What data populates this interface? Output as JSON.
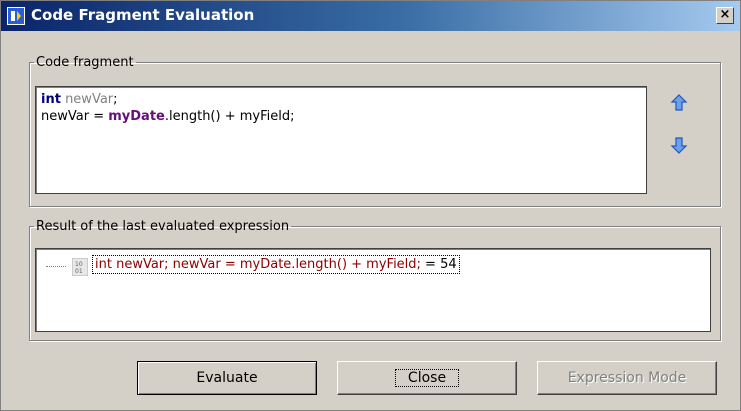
{
  "window": {
    "title": "Code Fragment Evaluation",
    "close_glyph": "×"
  },
  "code_group": {
    "legend": "Code fragment",
    "line1_keyword": "int",
    "line1_var": " newVar",
    "line1_end": ";",
    "line2_start": "newVar = ",
    "line2_field": "myDate",
    "line2_end": ".length() + myField;"
  },
  "result_group": {
    "legend": "Result of the last evaluated expression",
    "expression": "int newVar;  newVar = myDate.length() + myField;",
    "value": " = 54"
  },
  "buttons": {
    "evaluate": "Evaluate",
    "close": "Close",
    "expression_mode": "Expression Mode"
  },
  "icons": {
    "app": "code-eval-app-icon",
    "history_up": "up-arrow-icon",
    "history_down": "down-arrow-icon",
    "result": "number-value-icon"
  },
  "colors": {
    "title_gradient_start": "#0a246a",
    "keyword": "#000080",
    "field": "#660e7a",
    "expression": "#8b0000",
    "arrows": "#3a78d6"
  }
}
